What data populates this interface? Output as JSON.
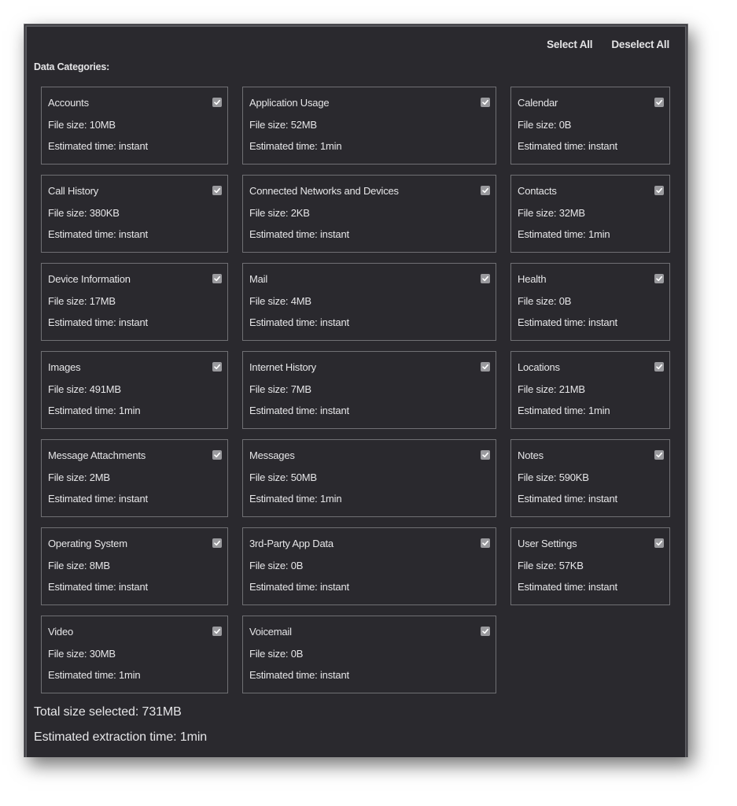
{
  "header": {
    "section_title": "Data Categories:",
    "select_all": "Select All",
    "deselect_all": "Deselect All"
  },
  "categories": [
    {
      "name": "Accounts",
      "size": "File size: 10MB",
      "time": "Estimated time: instant",
      "checked": true
    },
    {
      "name": "Application Usage",
      "size": "File size: 52MB",
      "time": "Estimated time: 1min",
      "checked": true
    },
    {
      "name": "Calendar",
      "size": "File size: 0B",
      "time": "Estimated time: instant",
      "checked": true
    },
    {
      "name": "Call History",
      "size": "File size: 380KB",
      "time": "Estimated time: instant",
      "checked": true
    },
    {
      "name": "Connected Networks and Devices",
      "size": "File size: 2KB",
      "time": "Estimated time: instant",
      "checked": true
    },
    {
      "name": "Contacts",
      "size": "File size: 32MB",
      "time": "Estimated time: 1min",
      "checked": true
    },
    {
      "name": "Device Information",
      "size": "File size: 17MB",
      "time": "Estimated time: instant",
      "checked": true
    },
    {
      "name": "Mail",
      "size": "File size: 4MB",
      "time": "Estimated time: instant",
      "checked": true
    },
    {
      "name": "Health",
      "size": "File size: 0B",
      "time": "Estimated time: instant",
      "checked": true
    },
    {
      "name": "Images",
      "size": "File size: 491MB",
      "time": "Estimated time: 1min",
      "checked": true
    },
    {
      "name": "Internet History",
      "size": "File size: 7MB",
      "time": "Estimated time: instant",
      "checked": true
    },
    {
      "name": "Locations",
      "size": "File size: 21MB",
      "time": "Estimated time: 1min",
      "checked": true
    },
    {
      "name": "Message Attachments",
      "size": "File size: 2MB",
      "time": "Estimated time: instant",
      "checked": true
    },
    {
      "name": "Messages",
      "size": "File size: 50MB",
      "time": "Estimated time: 1min",
      "checked": true
    },
    {
      "name": "Notes",
      "size": "File size: 590KB",
      "time": "Estimated time: instant",
      "checked": true
    },
    {
      "name": "Operating System",
      "size": "File size: 8MB",
      "time": "Estimated time: instant",
      "checked": true
    },
    {
      "name": "3rd-Party App Data",
      "size": "File size: 0B",
      "time": "Estimated time: instant",
      "checked": true
    },
    {
      "name": "User Settings",
      "size": "File size: 57KB",
      "time": "Estimated time: instant",
      "checked": true
    },
    {
      "name": "Video",
      "size": "File size: 30MB",
      "time": "Estimated time: 1min",
      "checked": true
    },
    {
      "name": "Voicemail",
      "size": "File size: 0B",
      "time": "Estimated time: instant",
      "checked": true
    }
  ],
  "summary": {
    "total_size": "Total size selected: 731MB",
    "extraction_time": "Estimated extraction time: 1min"
  },
  "colors": {
    "panel_bg": "#2a292e",
    "card_border": "#707074",
    "text": "#e6e6e8",
    "checkbox": "#9a9a9e"
  }
}
